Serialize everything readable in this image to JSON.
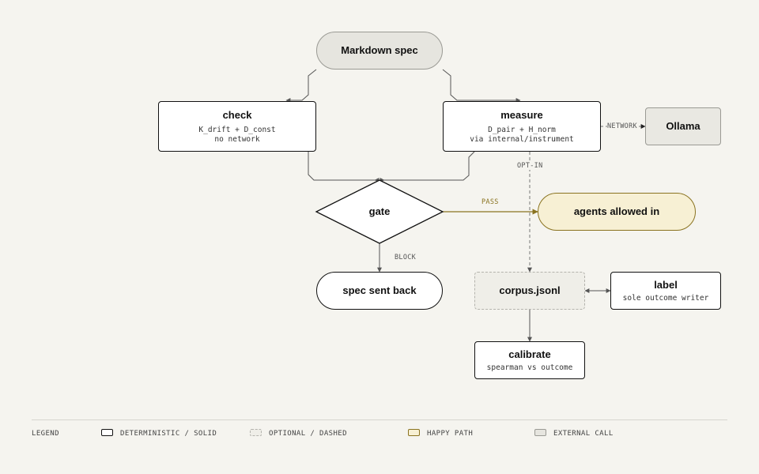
{
  "nodes": {
    "markdown_spec": {
      "title": "Markdown spec"
    },
    "check": {
      "title": "check",
      "sub1": "K_drift + D_const",
      "sub2": "no network"
    },
    "measure": {
      "title": "measure",
      "sub1": "D_pair + H_norm",
      "sub2": "via internal/instrument"
    },
    "ollama": {
      "title": "Ollama"
    },
    "gate": {
      "title": "gate"
    },
    "agents": {
      "title": "agents allowed in"
    },
    "spec_back": {
      "title": "spec sent back"
    },
    "corpus": {
      "title": "corpus.jsonl"
    },
    "label": {
      "title": "label",
      "sub": "sole outcome writer"
    },
    "calibrate": {
      "title": "calibrate",
      "sub": "spearman vs outcome"
    }
  },
  "edge_labels": {
    "network": "NETWORK",
    "opt_in": "OPT-IN",
    "pass": "PASS",
    "block": "BLOCK"
  },
  "legend": {
    "title": "LEGEND",
    "items": [
      {
        "style": "solid",
        "label": "DETERMINISTIC / SOLID"
      },
      {
        "style": "dashed",
        "label": "OPTIONAL / DASHED"
      },
      {
        "style": "happy",
        "label": "HAPPY PATH"
      },
      {
        "style": "external",
        "label": "EXTERNAL CALL"
      }
    ]
  },
  "colors": {
    "background": "#f5f4ef",
    "stroke": "#111111",
    "happy_path": "#8a7320",
    "happy_fill": "#f7f0d4",
    "external_fill": "#e6e5df",
    "dashed_stroke": "#b4b3ad"
  }
}
